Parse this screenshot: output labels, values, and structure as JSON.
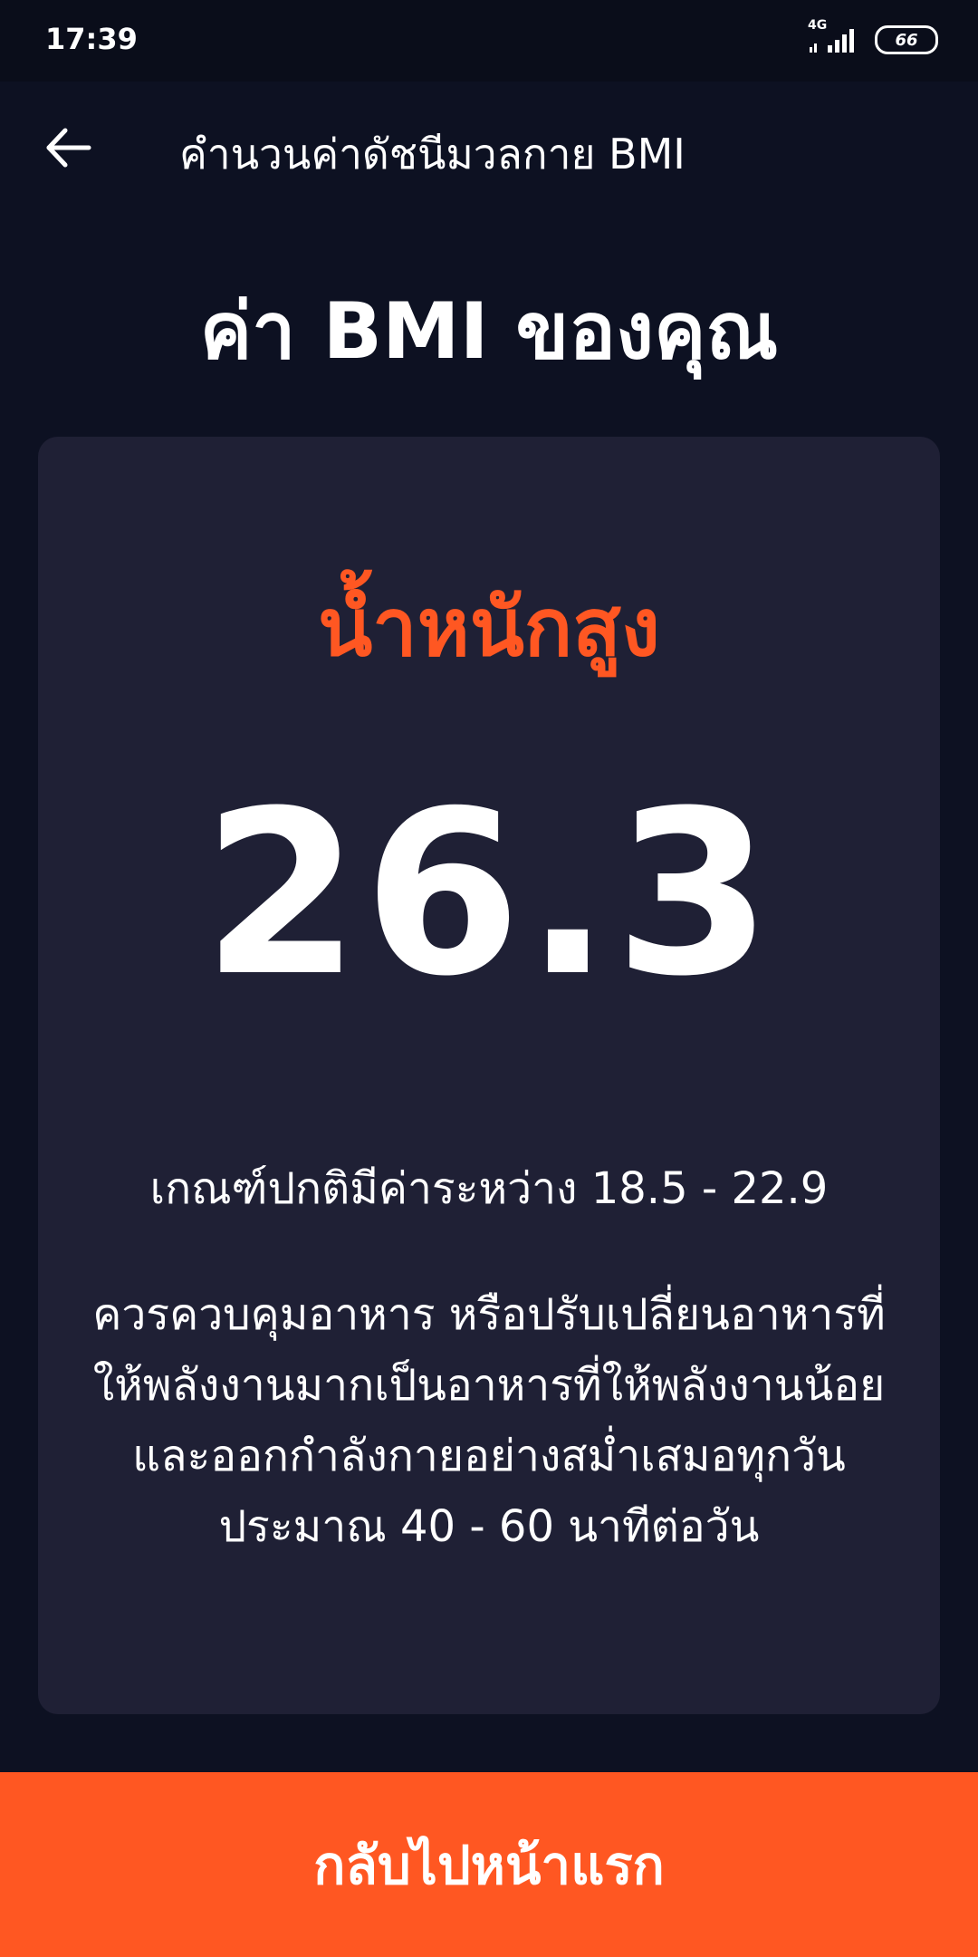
{
  "status_bar": {
    "time": "17:39",
    "network": "4G",
    "battery": "66",
    "icons": [
      "signal-icon",
      "battery-icon"
    ]
  },
  "app_bar": {
    "title": "คำนวนค่าดัชนีมวลกาย BMI",
    "back_icon": "arrow-left-icon"
  },
  "result": {
    "headline": "ค่า BMI ของคุณ",
    "status_label": "น้ำหนักสูง",
    "bmi_value": "26.3",
    "range_text": "เกณฑ์ปกติมีค่าระหว่าง 18.5 - 22.9",
    "advice": "ควรควบคุมอาหาร หรือปรับเปลี่ยนอาหารที่ให้พลังงานมากเป็นอาหารที่ให้พลังงานน้อยและออกกำลังกายอย่างสม่ำเสมอทุกวัน ประมาณ 40 - 60 นาทีต่อวัน"
  },
  "footer": {
    "button_label": "กลับไปหน้าแรก"
  },
  "colors": {
    "background": "#0d1122",
    "card": "#1f2035",
    "accent": "#ff5722",
    "text": "#ffffff"
  }
}
